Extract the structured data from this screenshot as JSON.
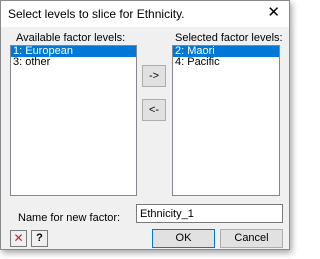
{
  "window": {
    "title": "Select levels to slice for Ethnicity."
  },
  "available": {
    "header": "Available factor levels:",
    "items": [
      "1: European",
      "3: other"
    ],
    "selected_index": 0
  },
  "selected": {
    "header": "Selected factor levels:",
    "items": [
      "2: Maori",
      "4: Pacific"
    ],
    "selected_index": 0
  },
  "buttons": {
    "add": "->",
    "remove": "<-",
    "ok": "OK",
    "cancel": "Cancel"
  },
  "new_factor": {
    "label": "Name for new factor:",
    "value": "Ethnicity_1"
  },
  "icons": {
    "close": "✕",
    "clear": "✕",
    "help": "?"
  },
  "colors": {
    "selection": "#0078d7",
    "clear_icon": "#c0282d"
  }
}
